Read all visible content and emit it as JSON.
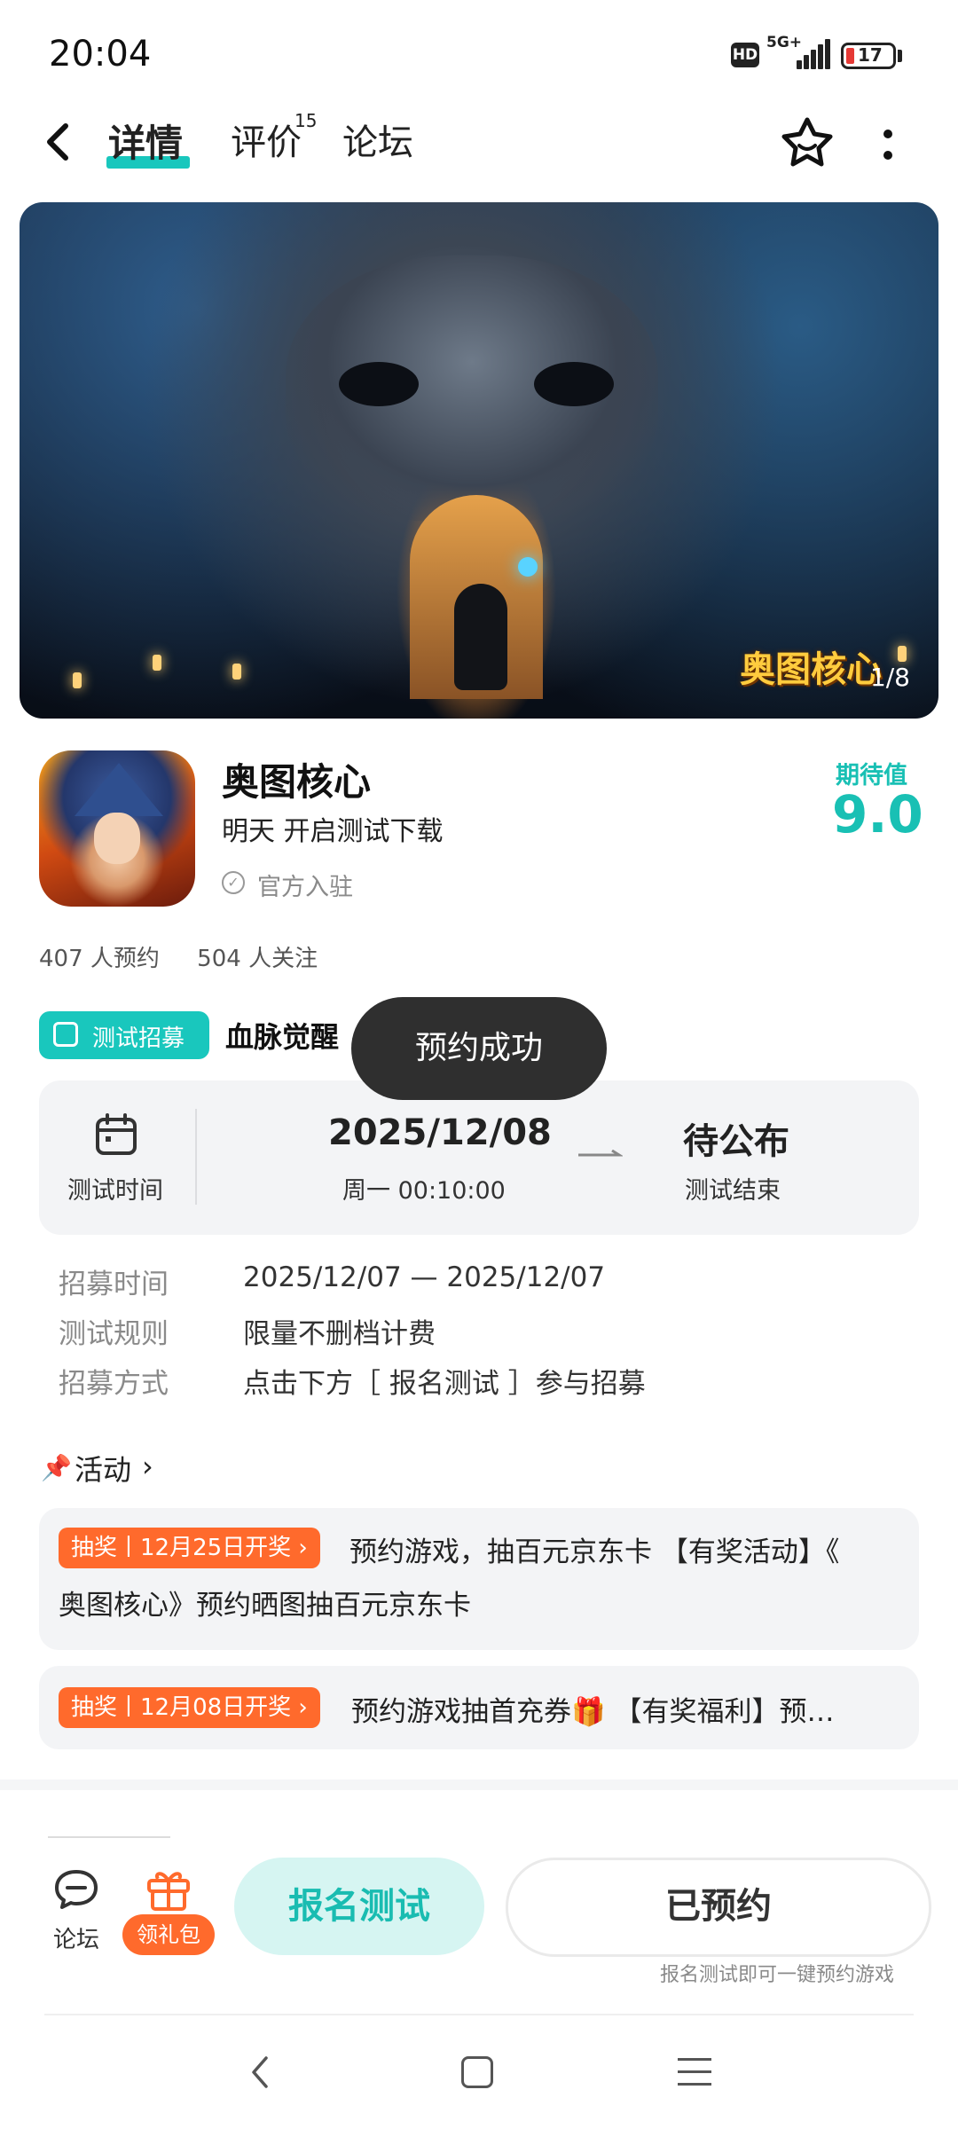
{
  "status_bar": {
    "time": "20:04",
    "hd": "HD",
    "network": "5G+",
    "battery": "17"
  },
  "nav": {
    "tabs": [
      {
        "label": "详情"
      },
      {
        "label": "评价",
        "badge": "15"
      },
      {
        "label": "论坛"
      }
    ]
  },
  "banner": {
    "logo_text": "奥图核心",
    "counter": "1/8"
  },
  "app": {
    "name": "奥图核心",
    "subtitle": "明天 开启测试下载",
    "official": "官方入驻",
    "expect_label": "期待值",
    "expect_value": "9.0"
  },
  "stats": {
    "reservations": "407 人预约",
    "followers": "504 人关注"
  },
  "recruit": {
    "tag": "测试招募",
    "name": "血脉觉醒"
  },
  "toast": "预约成功",
  "test_time": {
    "label": "测试时间",
    "start_date": "2025/12/08",
    "start_time": "周一  00:10:00",
    "end_status": "待公布",
    "end_label": "测试结束"
  },
  "info": [
    {
      "key": "招募时间",
      "value": "2025/12/07 — 2025/12/07"
    },
    {
      "key": "测试规则",
      "value": "限量不删档计费"
    },
    {
      "key": "招募方式",
      "value": "点击下方［ 报名测试 ］参与招募"
    }
  ],
  "activities": {
    "title": "活动",
    "items": [
      {
        "tag": "抽奖丨12月25日开奖 ›",
        "line1": "预约游戏，抽百元京东卡 【有奖活动】《",
        "line2": "奥图核心》预约晒图抽百元京东卡"
      },
      {
        "tag": "抽奖丨12月08日开奖 ›",
        "line1": "预约游戏抽首充券🎁 【有奖福利】预…"
      }
    ]
  },
  "bottom": {
    "forum": "论坛",
    "gift": "领礼包",
    "signup": "报名测试",
    "reserved": "已预约",
    "hint": "报名测试即可一键预约游戏"
  },
  "colors": {
    "accent": "#19c7bd",
    "orange": "#ff6a2c",
    "toast_bg": "#2f2f2f"
  }
}
